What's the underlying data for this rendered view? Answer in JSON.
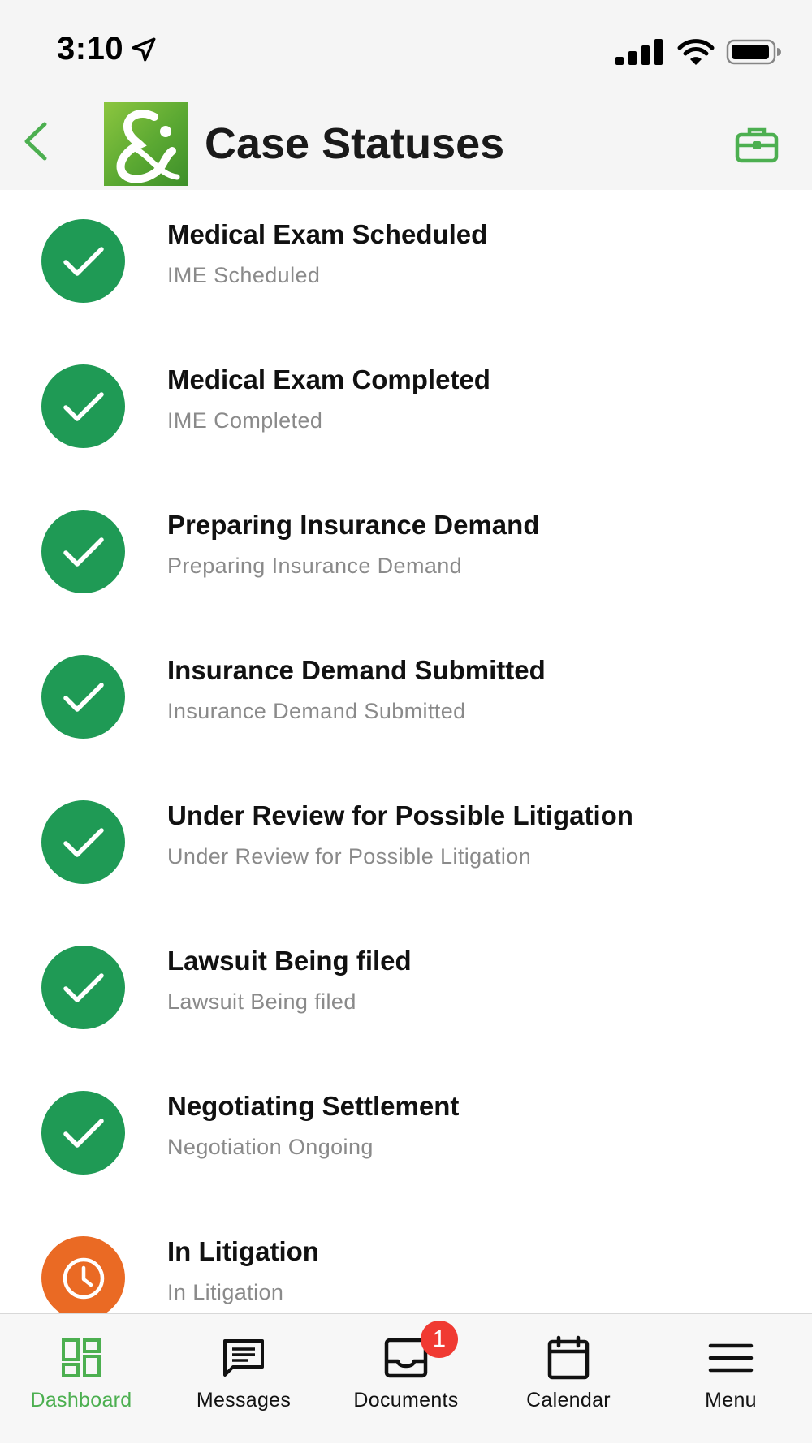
{
  "status_bar": {
    "time": "3:10"
  },
  "header": {
    "title": "Case Statuses"
  },
  "statuses": [
    {
      "title": "Medical Exam Scheduled",
      "subtitle": "IME Scheduled",
      "state": "completed"
    },
    {
      "title": "Medical Exam Completed",
      "subtitle": "IME Completed",
      "state": "completed"
    },
    {
      "title": "Preparing Insurance Demand",
      "subtitle": "Preparing Insurance Demand",
      "state": "completed"
    },
    {
      "title": "Insurance Demand Submitted",
      "subtitle": "Insurance Demand Submitted",
      "state": "completed"
    },
    {
      "title": "Under Review for Possible Litigation",
      "subtitle": "Under Review for Possible Litigation",
      "state": "completed"
    },
    {
      "title": "Lawsuit Being filed",
      "subtitle": "Lawsuit Being filed",
      "state": "completed"
    },
    {
      "title": "Negotiating Settlement",
      "subtitle": "Negotiation Ongoing",
      "state": "completed"
    },
    {
      "title": "In Litigation",
      "subtitle": "In Litigation",
      "state": "in-progress"
    }
  ],
  "tabs": [
    {
      "label": "Dashboard",
      "icon": "dashboard-icon",
      "active": true
    },
    {
      "label": "Messages",
      "icon": "messages-icon",
      "active": false
    },
    {
      "label": "Documents",
      "icon": "inbox-icon",
      "active": false,
      "badge": "1"
    },
    {
      "label": "Calendar",
      "icon": "calendar-icon",
      "active": false
    },
    {
      "label": "Menu",
      "icon": "menu-icon",
      "active": false
    }
  ],
  "colors": {
    "accent_green": "#4caf50",
    "completed_circle": "#1f9a55",
    "in_progress_circle": "#ea6a24",
    "badge_red": "#f03a32"
  }
}
